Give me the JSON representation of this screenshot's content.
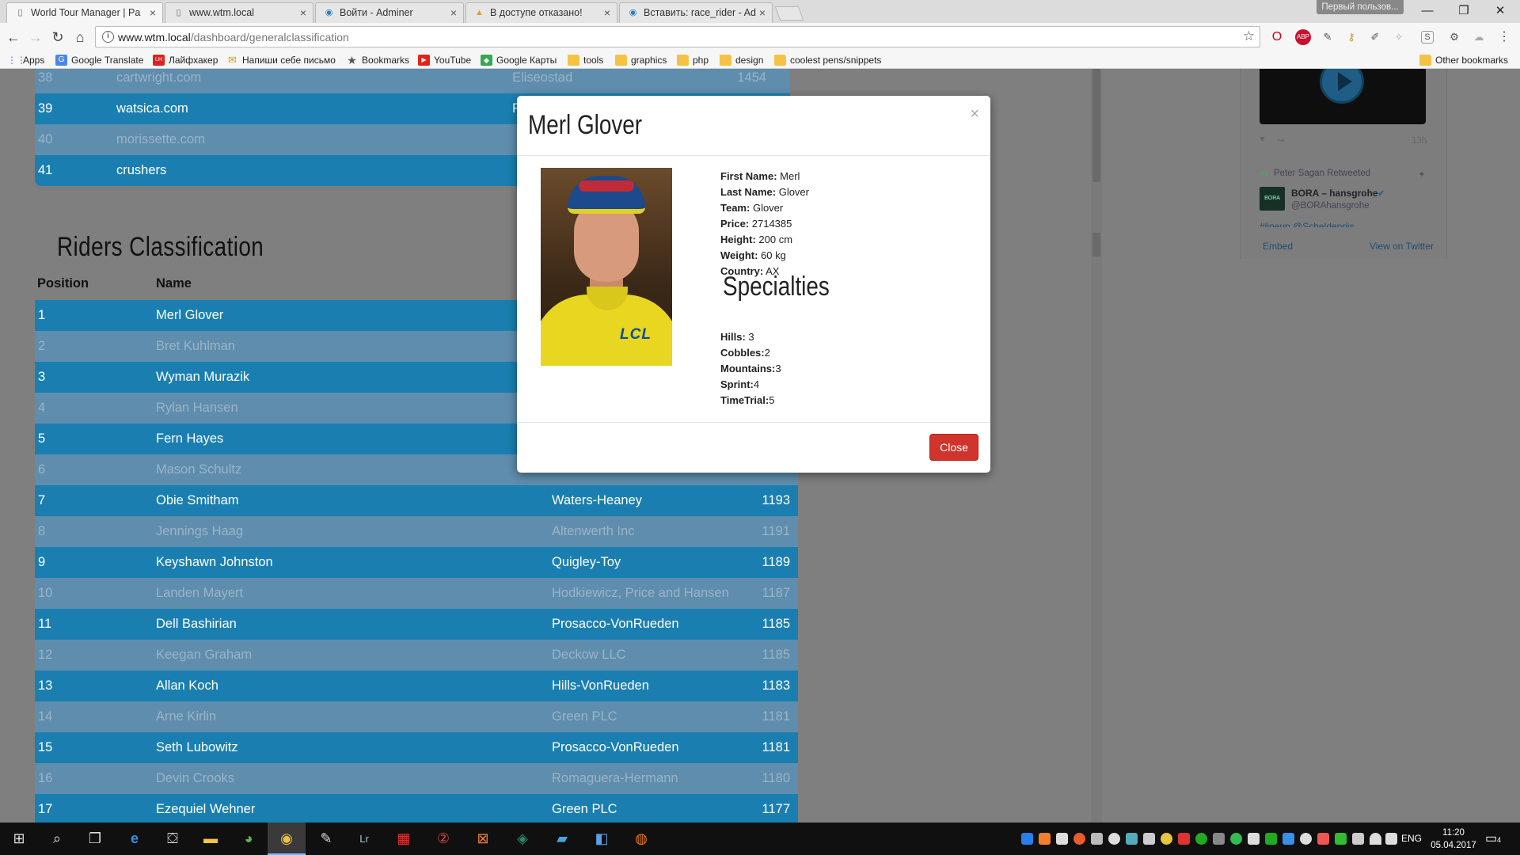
{
  "browser": {
    "tabs": [
      {
        "title": "World Tour Manager | Pa",
        "icon": "page-icon",
        "active": true
      },
      {
        "title": "www.wtm.local",
        "icon": "page-icon",
        "active": false
      },
      {
        "title": "Войти - Adminer",
        "icon": "adminer-icon",
        "active": false
      },
      {
        "title": "В доступе отказано!",
        "icon": "pma-icon",
        "active": false
      },
      {
        "title": "Вставить: race_rider - Ad",
        "icon": "adminer-icon",
        "active": false
      }
    ],
    "profile_name": "Первый пользов...",
    "url_host": "www.wtm.local",
    "url_path": "/dashboard/generalclassification",
    "bookmarks": [
      "Apps",
      "Google Translate",
      "Лайфхакер",
      "Напиши себе письмо",
      "Bookmarks",
      "YouTube",
      "Google Карты",
      "tools",
      "graphics",
      "php",
      "design",
      "coolest pens/snippets"
    ],
    "other_bookmarks": "Other bookmarks"
  },
  "teams_table": {
    "rows": [
      {
        "pos": "38",
        "name": "cartwright.com",
        "city": "Eliseostad",
        "pts": "1454"
      },
      {
        "pos": "39",
        "name": "watsica.com",
        "city": "R",
        "pts": ""
      },
      {
        "pos": "40",
        "name": "morissette.com",
        "city": "",
        "pts": ""
      },
      {
        "pos": "41",
        "name": "crushers",
        "city": "",
        "pts": ""
      }
    ]
  },
  "riders": {
    "title": "Riders Classification",
    "headers": {
      "position": "Position",
      "name": "Name"
    },
    "rows": [
      {
        "pos": "1",
        "name": "Merl Glover",
        "team": "",
        "pts": ""
      },
      {
        "pos": "2",
        "name": "Bret Kuhlman",
        "team": "",
        "pts": ""
      },
      {
        "pos": "3",
        "name": "Wyman Murazik",
        "team": "",
        "pts": ""
      },
      {
        "pos": "4",
        "name": "Rylan Hansen",
        "team": "",
        "pts": ""
      },
      {
        "pos": "5",
        "name": "Fern Hayes",
        "team": "",
        "pts": ""
      },
      {
        "pos": "6",
        "name": "Mason Schultz",
        "team": "",
        "pts": ""
      },
      {
        "pos": "7",
        "name": "Obie Smitham",
        "team": "Waters-Heaney",
        "pts": "1193"
      },
      {
        "pos": "8",
        "name": "Jennings Haag",
        "team": "Altenwerth Inc",
        "pts": "1191"
      },
      {
        "pos": "9",
        "name": "Keyshawn Johnston",
        "team": "Quigley-Toy",
        "pts": "1189"
      },
      {
        "pos": "10",
        "name": "Landen Mayert",
        "team": "Hodkiewicz, Price and Hansen",
        "pts": "1187"
      },
      {
        "pos": "11",
        "name": "Dell Bashirian",
        "team": "Prosacco-VonRueden",
        "pts": "1185"
      },
      {
        "pos": "12",
        "name": "Keegan Graham",
        "team": "Deckow LLC",
        "pts": "1185"
      },
      {
        "pos": "13",
        "name": "Allan Koch",
        "team": "Hills-VonRueden",
        "pts": "1183"
      },
      {
        "pos": "14",
        "name": "Arne Kirlin",
        "team": "Green PLC",
        "pts": "1181"
      },
      {
        "pos": "15",
        "name": "Seth Lubowitz",
        "team": "Prosacco-VonRueden",
        "pts": "1181"
      },
      {
        "pos": "16",
        "name": "Devin Crooks",
        "team": "Romaguera-Hermann",
        "pts": "1180"
      },
      {
        "pos": "17",
        "name": "Ezequiel Wehner",
        "team": "Green PLC",
        "pts": "1177"
      }
    ]
  },
  "twitter": {
    "retweeted_by": "Peter Sagan Retweeted",
    "account_name": "BORA – hansgrohe",
    "account_handle": "@BORAhansgrohe",
    "hashtag_line": "#lineup @Scheldepriis",
    "time": "13h",
    "embed": "Embed",
    "view_on_twitter": "View on Twitter"
  },
  "modal": {
    "title": "Merl Glover",
    "close_x": "×",
    "info": [
      {
        "label": "First Name:",
        "value": "Merl"
      },
      {
        "label": "Last Name:",
        "value": "Glover"
      },
      {
        "label": "Team:",
        "value": "Glover"
      },
      {
        "label": "Price:",
        "value": "2714385"
      },
      {
        "label": "Height:",
        "value": "200 cm"
      },
      {
        "label": "Weight:",
        "value": "60 kg"
      },
      {
        "label": "Country:",
        "value": "AX"
      }
    ],
    "specialties_title": "Specialties",
    "specialties": [
      {
        "label": "Hills:",
        "value": "3"
      },
      {
        "label": "Cobbles:",
        "value": "2"
      },
      {
        "label": "Mountains:",
        "value": "3"
      },
      {
        "label": "Sprint:",
        "value": "4"
      },
      {
        "label": "TimeTrial:",
        "value": "5"
      }
    ],
    "photo_logo": "LCL",
    "close_button": "Close"
  },
  "taskbar": {
    "language": "ENG",
    "time": "11:20",
    "date": "05.04.2017",
    "notifications": "4"
  },
  "colors": {
    "row_odd": "#1a7fb0",
    "row_even": "#5f8dad",
    "close_button": "#d0342c"
  }
}
